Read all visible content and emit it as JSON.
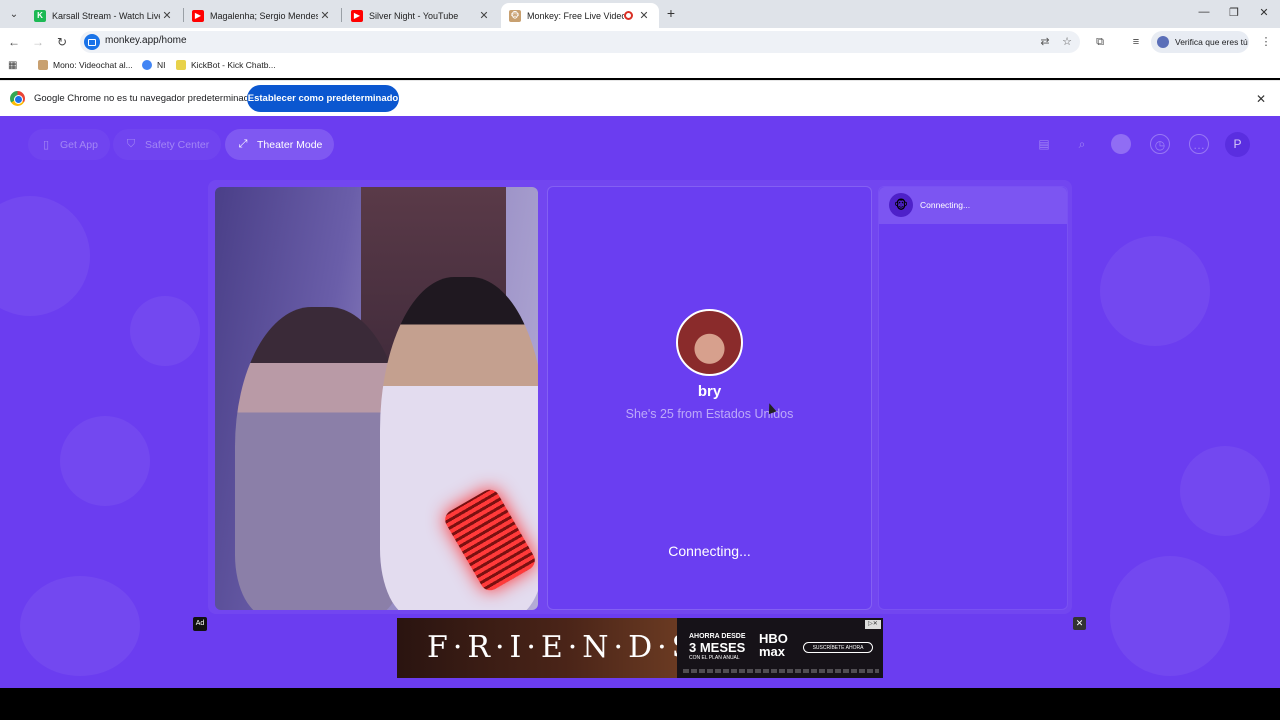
{
  "browser": {
    "tabs": [
      {
        "title": "Karsall Stream - Watch Live on",
        "favicon_color": "#1db954",
        "favicon_char": "K"
      },
      {
        "title": "Magalenha; Sergio Mendes [Le",
        "favicon_color": "#ff0000",
        "favicon_char": "▶"
      },
      {
        "title": "Silver Night - YouTube",
        "favicon_color": "#ff0000",
        "favicon_char": "▶"
      },
      {
        "title": "Monkey: Free Live Video Ch",
        "favicon_color": "#c8a070",
        "favicon_char": "🐵",
        "active": true
      }
    ],
    "new_tab_icon": "plus-icon",
    "window_controls": {
      "minimize": "—",
      "restore": "❐",
      "close": "✕"
    },
    "url": "monkey.app/home",
    "profile_label": "Verifica que eres tú",
    "bookmarks": [
      {
        "label": "Mono: Videochat al...",
        "color": "#c8a070"
      },
      {
        "label": "NI",
        "color": "#4285f4"
      },
      {
        "label": "KickBot - Kick Chatb...",
        "color": "#e8d24a"
      }
    ],
    "infobar": {
      "text": "Google Chrome no es tu navegador predeterminado",
      "button": "Establecer como predeterminado"
    }
  },
  "app": {
    "accent": "#6b3df0",
    "nav": {
      "get_app": "Get App",
      "safety_center": "Safety Center",
      "theater_mode": "Theater Mode"
    },
    "header_icons": [
      "shop-icon",
      "search-icon",
      "avatar-icon",
      "history-icon",
      "chat-icon"
    ],
    "profile_initial": "P",
    "peer": {
      "name": "bry",
      "info": "She's 25 from Estados Unidos"
    },
    "status": "Connecting...",
    "chat": {
      "status": "Connecting..."
    },
    "ad": {
      "label": "Ad",
      "close": "✕",
      "title": "F·R·I·E·N·D·S",
      "small": "AHORRA DESDE",
      "big": "3 MESES",
      "plan": "CON EL PLAN ANUAL",
      "brand": "HBO max",
      "cta": "SUSCRÍBETE AHORA"
    }
  }
}
